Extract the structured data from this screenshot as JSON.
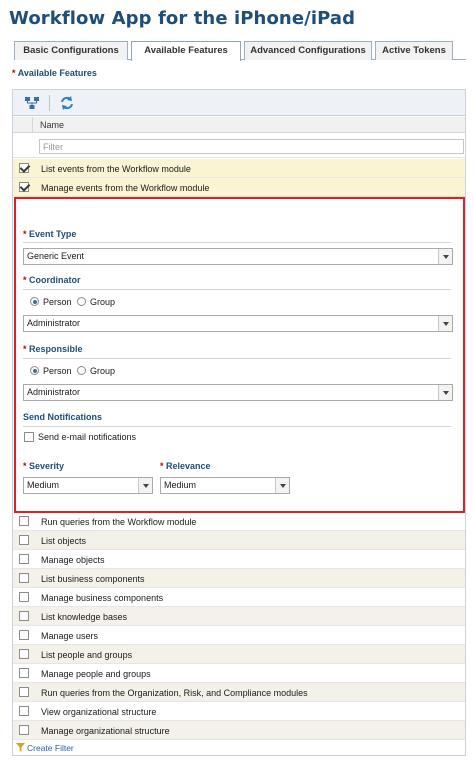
{
  "page": {
    "title": "Workflow App for the iPhone/iPad"
  },
  "tabs": [
    {
      "label": "Basic Configurations",
      "active": false
    },
    {
      "label": "Available Features",
      "active": true
    },
    {
      "label": "Advanced Configurations",
      "active": false
    },
    {
      "label": "Active Tokens",
      "active": false
    }
  ],
  "section": {
    "required_mark": "*",
    "label": "Available Features"
  },
  "grid": {
    "toolbar": {
      "icons": [
        "hierarchy-icon",
        "refresh-icon"
      ]
    },
    "column_header": "Name",
    "filter_placeholder": "Filter",
    "top_rows": [
      {
        "label": "List events from the Workflow module",
        "checked": true
      },
      {
        "label": "Manage events from the Workflow module",
        "checked": true
      }
    ],
    "detail": {
      "required_mark": "*",
      "event_type": {
        "label": "Event Type",
        "value": "Generic Event"
      },
      "coordinator": {
        "label": "Coordinator",
        "radio_person": "Person",
        "radio_group": "Group",
        "selected": "Person",
        "value": "Administrator"
      },
      "responsible": {
        "label": "Responsible",
        "radio_person": "Person",
        "radio_group": "Group",
        "selected": "Person",
        "value": "Administrator"
      },
      "notifications": {
        "label": "Send Notifications",
        "checkbox_label": "Send e-mail notifications",
        "checked": false
      },
      "severity": {
        "label": "Severity",
        "value": "Medium"
      },
      "relevance": {
        "label": "Relevance",
        "value": "Medium"
      }
    },
    "rows": [
      {
        "label": "Run queries from the Workflow module",
        "checked": false
      },
      {
        "label": "List objects",
        "checked": false
      },
      {
        "label": "Manage objects",
        "checked": false
      },
      {
        "label": "List business components",
        "checked": false
      },
      {
        "label": "Manage business components",
        "checked": false
      },
      {
        "label": "List knowledge bases",
        "checked": false
      },
      {
        "label": "Manage users",
        "checked": false
      },
      {
        "label": "List people and groups",
        "checked": false
      },
      {
        "label": "Manage people and groups",
        "checked": false
      },
      {
        "label": "Run queries from the Organization, Risk, and Compliance modules",
        "checked": false
      },
      {
        "label": "View organizational structure",
        "checked": false
      },
      {
        "label": "Manage organizational structure",
        "checked": false
      }
    ],
    "create_filter": "Create Filter"
  },
  "colors": {
    "title": "#1f4e79",
    "selected_row": "#fbf4d3",
    "highlight_border": "#e02020",
    "link": "#2a5fa8"
  }
}
